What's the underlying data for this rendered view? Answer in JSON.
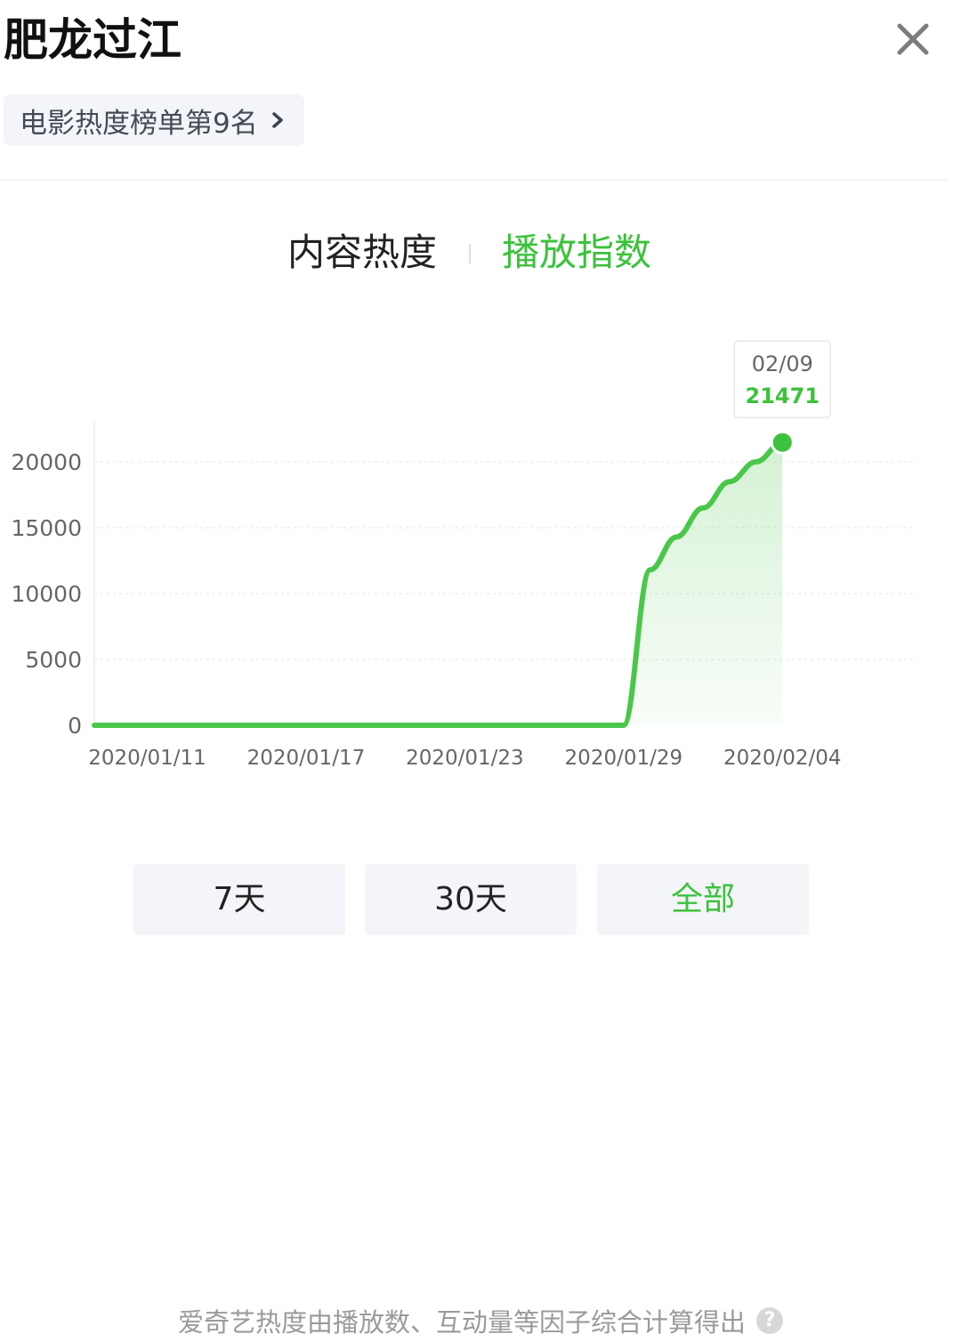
{
  "header": {
    "title": "肥龙过江",
    "rank_label": "电影热度榜单第9名",
    "close_icon": "close-icon",
    "chevron_icon": "chevron-right-icon"
  },
  "tabs": [
    {
      "label": "内容热度",
      "active": false
    },
    {
      "label": "播放指数",
      "active": true
    }
  ],
  "colors": {
    "accent": "#3cc23c",
    "text": "#222222",
    "muted": "#9a9a9a",
    "button_bg": "#f4f5f9"
  },
  "chart_data": {
    "type": "area",
    "x": [
      "2020/01/09",
      "2020/01/10",
      "2020/01/11",
      "2020/01/12",
      "2020/01/13",
      "2020/01/14",
      "2020/01/15",
      "2020/01/16",
      "2020/01/17",
      "2020/01/18",
      "2020/01/19",
      "2020/01/20",
      "2020/01/21",
      "2020/01/22",
      "2020/01/23",
      "2020/01/24",
      "2020/01/25",
      "2020/01/26",
      "2020/01/27",
      "2020/01/28",
      "2020/01/29",
      "2020/01/30",
      "2020/01/31",
      "2020/02/01",
      "2020/02/02",
      "2020/02/03",
      "2020/02/04",
      "2020/02/05",
      "2020/02/06",
      "2020/02/07",
      "2020/02/08",
      "2020/02/09"
    ],
    "values": [
      0,
      0,
      0,
      0,
      0,
      0,
      0,
      0,
      0,
      0,
      0,
      0,
      0,
      0,
      0,
      0,
      0,
      0,
      0,
      0,
      0,
      11800,
      14300,
      16500,
      18500,
      20000,
      21471
    ],
    "x_tick_labels": [
      "2020/01/11",
      "2020/01/17",
      "2020/01/23",
      "2020/01/29",
      "2020/02/04"
    ],
    "y_ticks": [
      0,
      5000,
      10000,
      15000,
      20000
    ],
    "ylim": [
      0,
      22500
    ],
    "grid": true,
    "tooltip": {
      "date": "02/09",
      "value": "21471"
    }
  },
  "range_buttons": [
    {
      "label": "7天",
      "active": false
    },
    {
      "label": "30天",
      "active": false
    },
    {
      "label": "全部",
      "active": true
    }
  ],
  "footer": {
    "text": "爱奇艺热度由播放数、互动量等因子综合计算得出",
    "help_glyph": "?",
    "help_icon": "question-circle-icon"
  }
}
